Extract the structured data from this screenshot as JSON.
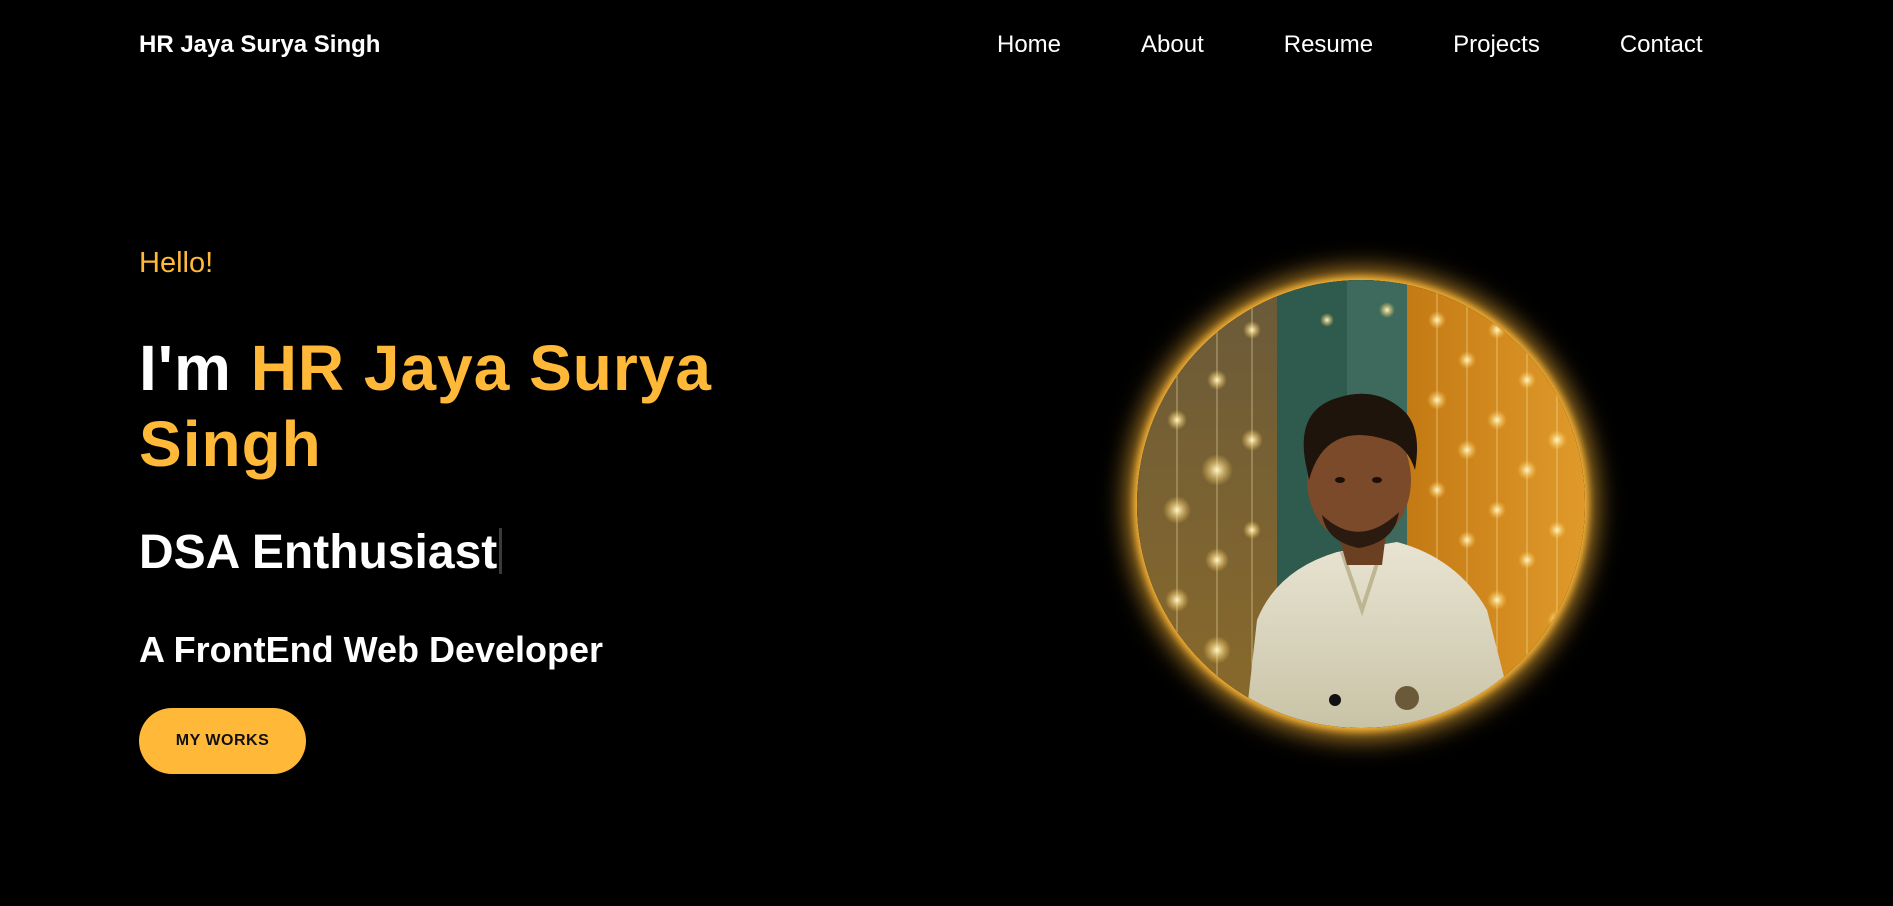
{
  "navbar": {
    "brand": "HR Jaya Surya Singh",
    "links": [
      {
        "label": "Home"
      },
      {
        "label": "About"
      },
      {
        "label": "Resume"
      },
      {
        "label": "Projects"
      },
      {
        "label": "Contact"
      }
    ]
  },
  "hero": {
    "greeting": "Hello!",
    "intro_prefix": "I'm ",
    "name": "HR Jaya Surya Singh",
    "typed_text": "DSA Enthusiast",
    "subtitle": "A FrontEnd Web Developer",
    "cta_label": "MY WORKS"
  },
  "colors": {
    "background": "#000000",
    "accent": "#ffb838",
    "text": "#ffffff"
  },
  "icons": {
    "portrait": "profile-photo"
  }
}
